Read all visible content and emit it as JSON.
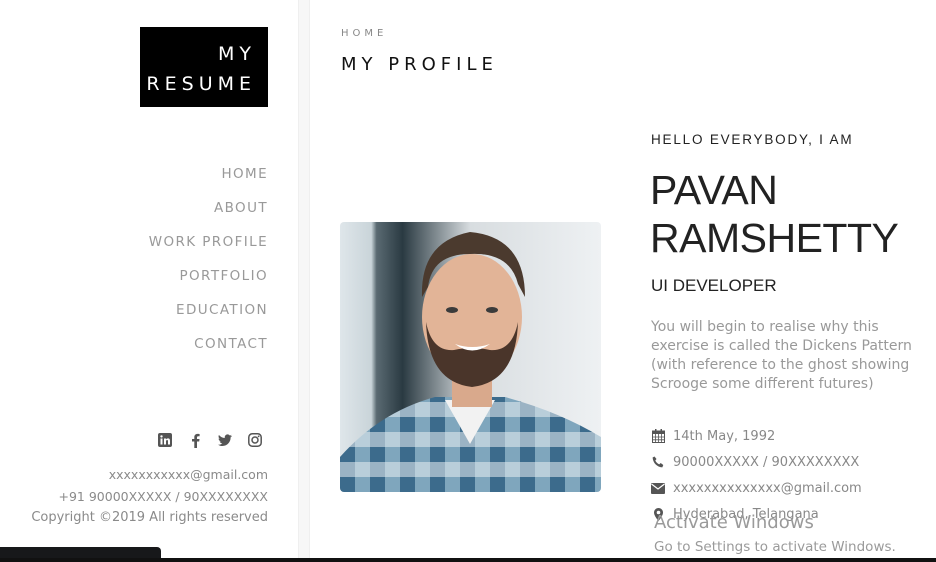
{
  "sidebar": {
    "logo_line1": "MY",
    "logo_line2": "RESUME",
    "nav": [
      {
        "label": "HOME"
      },
      {
        "label": "ABOUT"
      },
      {
        "label": "WORK PROFILE"
      },
      {
        "label": "PORTFOLIO"
      },
      {
        "label": "EDUCATION"
      },
      {
        "label": "CONTACT"
      }
    ],
    "socials": [
      "linkedin-icon",
      "facebook-icon",
      "twitter-icon",
      "instagram-icon"
    ],
    "email": "xxxxxxxxxxx@gmail.com",
    "phone": "+91 90000XXXXX / 90XXXXXXXX",
    "copyright": "Copyright ©2019 All rights reserved"
  },
  "main": {
    "breadcrumb": "HOME",
    "title": "MY PROFILE",
    "greeting": "HELLO EVERYBODY, I AM",
    "first_name": "PAVAN",
    "last_name": "RAMSHETTY",
    "role": "UI DEVELOPER",
    "bio": "You will begin to realise why this exercise is called the Dickens Pattern (with reference to the ghost showing Scrooge some different futures)",
    "details": [
      {
        "icon": "calendar-icon",
        "text": "14th May, 1992"
      },
      {
        "icon": "phone-icon",
        "text": "90000XXXXX / 90XXXXXXXX"
      },
      {
        "icon": "envelope-icon",
        "text": "xxxxxxxxxxxxxx@gmail.com"
      },
      {
        "icon": "map-marker-icon",
        "text": "Hyderabad, Telangana"
      }
    ]
  },
  "os_overlay": {
    "watermark_title": "Activate Windows",
    "watermark_sub": "Go to Settings to activate Windows."
  }
}
